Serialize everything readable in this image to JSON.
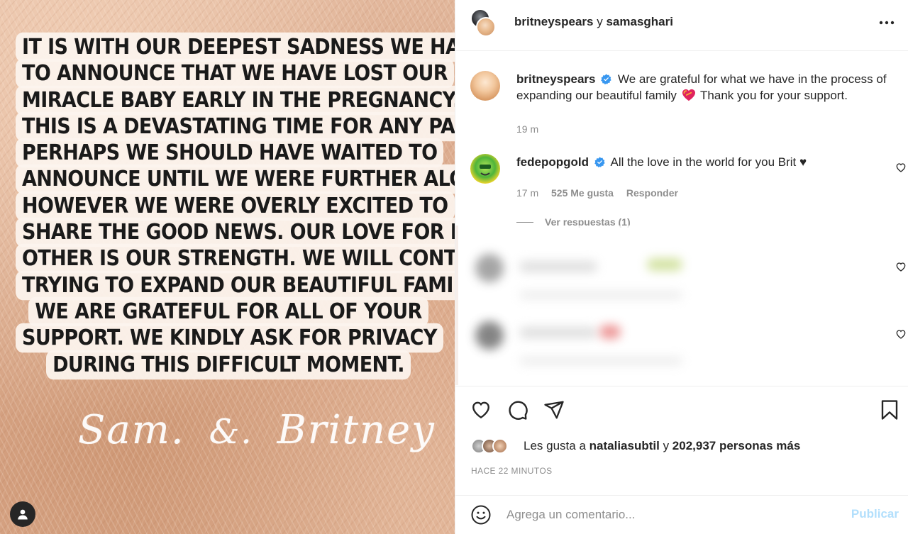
{
  "media": {
    "statement_lines": [
      "IT IS WITH OUR DEEPEST SADNESS WE HAVE",
      "TO ANNOUNCE THAT WE HAVE LOST OUR",
      "MIRACLE BABY EARLY IN THE PREGNANCY.",
      "THIS IS A DEVASTATING TIME FOR ANY PARENT.",
      "PERHAPS WE SHOULD HAVE WAITED TO",
      "ANNOUNCE UNTIL WE WERE FURTHER ALONG",
      "HOWEVER WE WERE OVERLY EXCITED TO",
      "SHARE THE GOOD NEWS. OUR LOVE FOR EACH",
      "OTHER IS OUR STRENGTH. WE WILL CONTINUE",
      "TRYING TO EXPAND OUR BEAUTIFUL FAMILY.",
      "WE ARE GRATEFUL FOR ALL OF YOUR",
      "SUPPORT.  WE KINDLY ASK FOR PRIVACY",
      "DURING THIS DIFFICULT MOMENT."
    ],
    "signature": {
      "name1": "Sam.",
      "amp": "&.",
      "name2": "Britney"
    },
    "tag_icon": "user-tag-icon"
  },
  "header": {
    "author": "britneyspears",
    "connector": "y",
    "coauthor": "samasghari",
    "more_icon": "more-options-icon"
  },
  "caption": {
    "username": "britneyspears",
    "text_before_emoji": "We are grateful for what we have in the process of expanding our beautiful family",
    "text_after_emoji": "Thank you for your support.",
    "emoji": "sparkling-heart-emoji",
    "time": "19 m"
  },
  "comments": [
    {
      "username": "fedepopgold",
      "text": "All the love in the world for you Brit ♥",
      "time": "17 m",
      "likes": "525 Me gusta",
      "reply": "Responder",
      "view_replies": "Ver respuestas (1)"
    }
  ],
  "actions": {
    "like_icon": "heart-icon",
    "comment_icon": "comment-icon",
    "share_icon": "share-icon",
    "save_icon": "bookmark-icon"
  },
  "likes": {
    "prefix": "Les gusta a",
    "user": "nataliasubtil",
    "connector": "y",
    "count": "202,937 personas más"
  },
  "timestamp": "HACE 22 MINUTOS",
  "add_comment": {
    "placeholder": "Agrega un comentario...",
    "publish": "Publicar"
  },
  "colors": {
    "accent": "#0095f6",
    "publish_disabled": "#b2dffc",
    "verified": "#3897f0",
    "muted": "#8e8e8e"
  }
}
